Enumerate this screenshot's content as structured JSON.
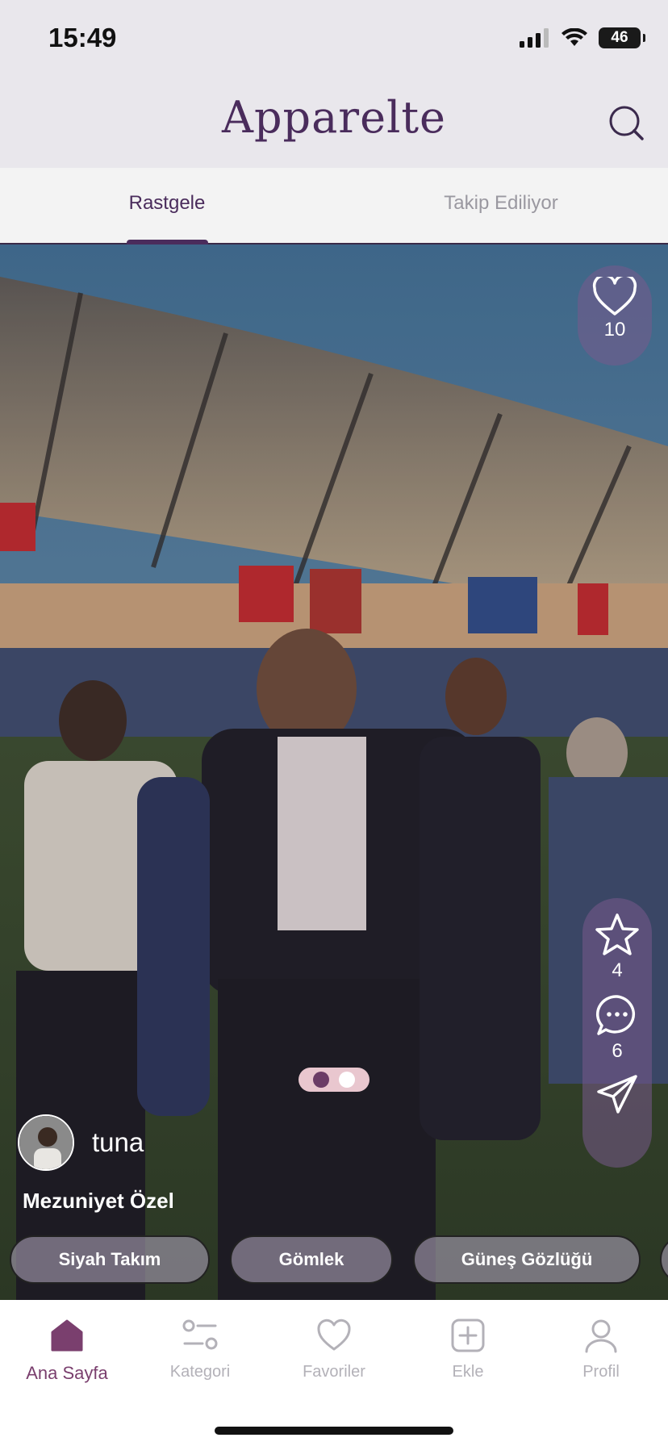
{
  "status_bar": {
    "time": "15:49",
    "battery": "46",
    "icons": [
      "signal-icon",
      "wifi-icon",
      "battery-icon"
    ]
  },
  "header": {
    "logo": "Apparelte",
    "search_icon": "search-icon"
  },
  "tabs": [
    {
      "label": "Rastgele",
      "active": true
    },
    {
      "label": "Takip Ediliyor",
      "active": false
    }
  ],
  "post": {
    "likes": "10",
    "stars": "4",
    "comments": "6",
    "author": "tuna",
    "title": "Mezuniyet Özel",
    "carousel": {
      "total": 2,
      "current": 1
    },
    "tags": [
      "Siyah Takım",
      "Gömlek",
      "Güneş Gözlüğü"
    ]
  },
  "tabbar": [
    {
      "label": "Ana Sayfa",
      "icon": "home-icon",
      "active": true
    },
    {
      "label": "Kategori",
      "icon": "category-icon",
      "active": false
    },
    {
      "label": "Favoriler",
      "icon": "heart-icon",
      "active": false
    },
    {
      "label": "Ekle",
      "icon": "add-icon",
      "active": false
    },
    {
      "label": "Profil",
      "icon": "profile-icon",
      "active": false
    }
  ],
  "colors": {
    "brand": "#4a2c5c",
    "active_tab": "#7a3f6e",
    "inactive": "#b3b1b8"
  }
}
